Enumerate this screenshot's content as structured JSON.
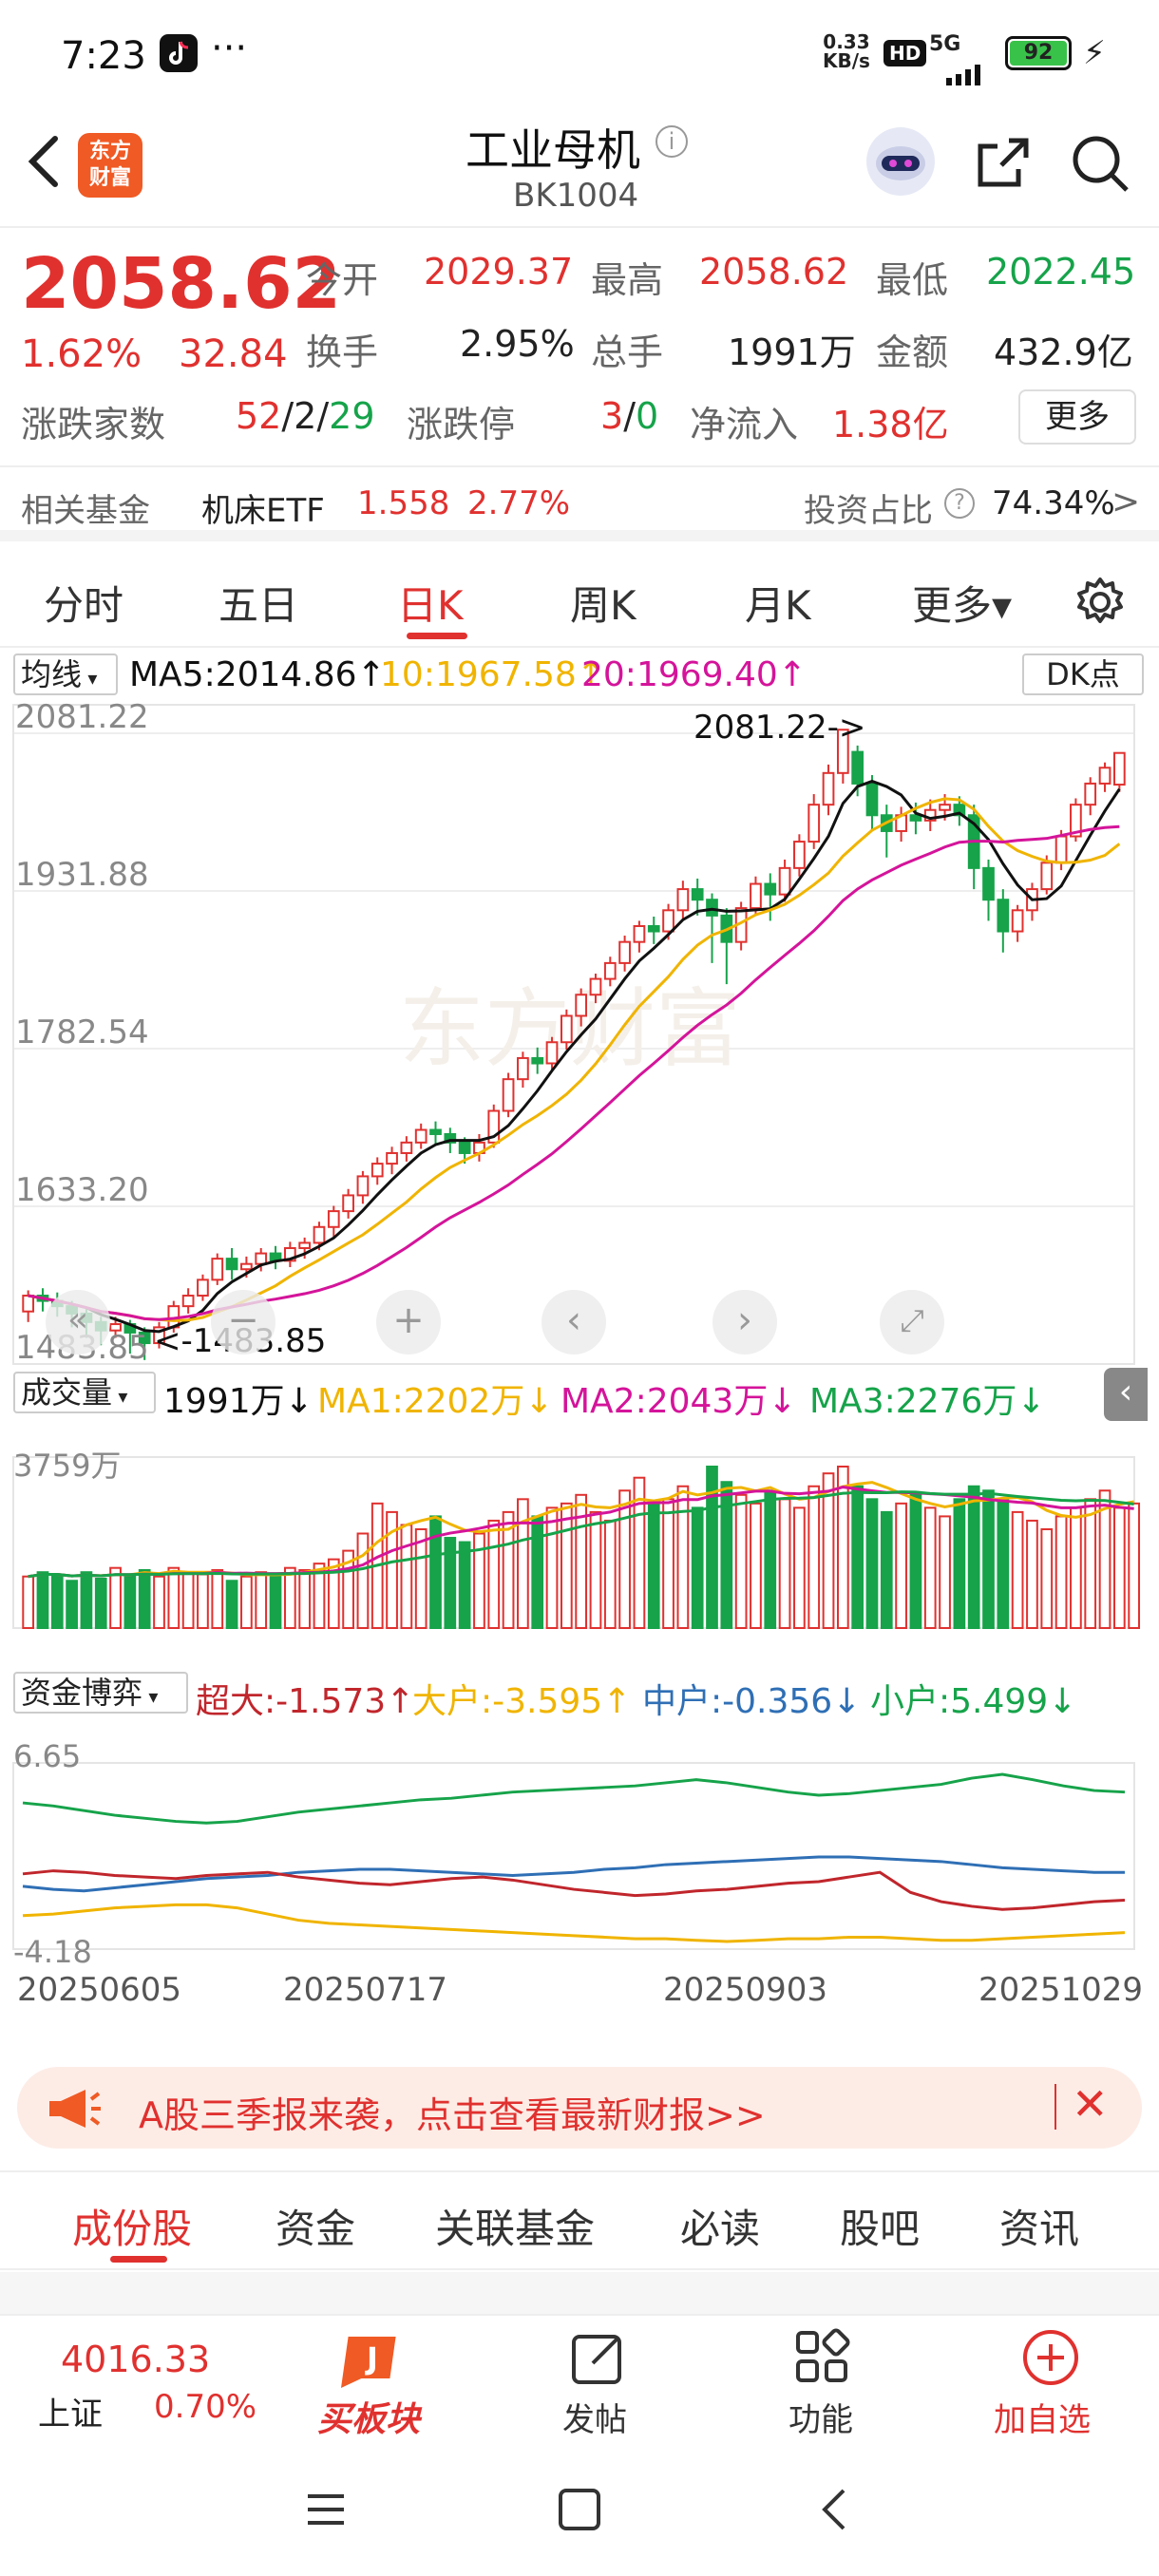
{
  "status_bar": {
    "time": "7:23",
    "net_speed_top": "0.33",
    "net_speed_bottom": "KB/s",
    "hd": "HD",
    "signal": "5G",
    "battery": "92"
  },
  "header": {
    "logo_line1": "东方",
    "logo_line2": "财富",
    "title": "工业母机",
    "code": "BK1004"
  },
  "quote": {
    "price": "2058.62",
    "change_pct": "1.62%",
    "change": "32.84",
    "open_label": "今开",
    "open": "2029.37",
    "high_label": "最高",
    "high": "2058.62",
    "low_label": "最低",
    "low": "2022.45",
    "turnover_label": "换手",
    "turnover": "2.95%",
    "volume_label": "总手",
    "volume": "1991万",
    "amount_label": "金额",
    "amount": "432.9亿",
    "breadth_label": "涨跌家数",
    "breadth_up": "52",
    "breadth_flat": "2",
    "breadth_down": "29",
    "limit_label": "涨跌停",
    "limit_up": "3",
    "limit_down": "0",
    "netflow_label": "净流入",
    "netflow": "1.38亿",
    "more_button": "更多"
  },
  "fund": {
    "label": "相关基金",
    "name": "机床ETF",
    "price": "1.558",
    "pct": "2.77%",
    "ratio_label": "投资占比",
    "ratio": "74.34%",
    "arrow": ">"
  },
  "tabs": [
    {
      "label": "分时"
    },
    {
      "label": "五日"
    },
    {
      "label": "日K"
    },
    {
      "label": "周K"
    },
    {
      "label": "月K"
    },
    {
      "label": "更多▾"
    }
  ],
  "ma_bar": {
    "selector": "均线",
    "ma5": "MA5:2014.86",
    "ma10": "10:1967.58",
    "ma20": "20:1969.40",
    "dk": "DK点"
  },
  "vol_bar": {
    "selector": "成交量",
    "vol": "1991万",
    "ma1": "MA1:2202万",
    "ma2": "MA2:2043万",
    "ma3": "MA3:2276万"
  },
  "flow_bar": {
    "selector": "资金博弈",
    "super": "超大:-1.573",
    "big": "大户:-3.595",
    "mid": "中户:-0.356",
    "small": "小户:5.499"
  },
  "chart_labels": {
    "max_label": "2081.22->",
    "min_label": "<-1483.85",
    "vol_max": "3759万",
    "flow_max": "6.65",
    "flow_min": "-4.18"
  },
  "colors": {
    "up": "#e0312f",
    "down": "#16a34a",
    "ma5": "#111111",
    "ma10": "#f0b400",
    "ma20": "#d4149a",
    "mid": "#2f6fb5"
  },
  "chart_data": [
    {
      "type": "candlestick",
      "title": "",
      "y_ticks": [
        "2081.22",
        "1931.88",
        "1782.54",
        "1633.20",
        "1483.85"
      ],
      "ylim": [
        1483.85,
        2081.22
      ],
      "x_ticks": [
        "20250605",
        "20250717",
        "20250903",
        "20251029"
      ],
      "candles": [
        [
          1530,
          1545,
          1520,
          1550
        ],
        [
          1545,
          1540,
          1530,
          1552
        ],
        [
          1540,
          1535,
          1525,
          1548
        ],
        [
          1535,
          1528,
          1515,
          1540
        ],
        [
          1528,
          1520,
          1505,
          1533
        ],
        [
          1520,
          1512,
          1498,
          1525
        ],
        [
          1512,
          1518,
          1505,
          1525
        ],
        [
          1518,
          1510,
          1490,
          1522
        ],
        [
          1510,
          1500,
          1484,
          1515
        ],
        [
          1500,
          1515,
          1495,
          1520
        ],
        [
          1515,
          1535,
          1510,
          1540
        ],
        [
          1535,
          1545,
          1528,
          1552
        ],
        [
          1545,
          1560,
          1540,
          1565
        ],
        [
          1560,
          1580,
          1555,
          1585
        ],
        [
          1580,
          1570,
          1560,
          1590
        ],
        [
          1570,
          1575,
          1562,
          1582
        ],
        [
          1575,
          1585,
          1568,
          1590
        ],
        [
          1585,
          1578,
          1570,
          1592
        ],
        [
          1578,
          1590,
          1572,
          1596
        ],
        [
          1590,
          1595,
          1580,
          1600
        ],
        [
          1595,
          1610,
          1588,
          1615
        ],
        [
          1610,
          1625,
          1600,
          1630
        ],
        [
          1625,
          1640,
          1618,
          1646
        ],
        [
          1640,
          1658,
          1632,
          1663
        ],
        [
          1658,
          1670,
          1650,
          1676
        ],
        [
          1670,
          1680,
          1660,
          1686
        ],
        [
          1680,
          1690,
          1672,
          1696
        ],
        [
          1690,
          1702,
          1684,
          1708
        ],
        [
          1702,
          1698,
          1688,
          1710
        ],
        [
          1698,
          1690,
          1680,
          1704
        ],
        [
          1690,
          1680,
          1670,
          1695
        ],
        [
          1680,
          1690,
          1672,
          1698
        ],
        [
          1690,
          1720,
          1685,
          1726
        ],
        [
          1720,
          1750,
          1714,
          1756
        ],
        [
          1750,
          1770,
          1742,
          1776
        ],
        [
          1770,
          1765,
          1755,
          1780
        ],
        [
          1765,
          1785,
          1758,
          1790
        ],
        [
          1785,
          1810,
          1778,
          1816
        ],
        [
          1810,
          1830,
          1800,
          1836
        ],
        [
          1830,
          1845,
          1822,
          1850
        ],
        [
          1845,
          1860,
          1838,
          1866
        ],
        [
          1860,
          1880,
          1852,
          1886
        ],
        [
          1880,
          1895,
          1870,
          1900
        ],
        [
          1895,
          1890,
          1878,
          1904
        ],
        [
          1890,
          1910,
          1882,
          1916
        ],
        [
          1910,
          1930,
          1900,
          1938
        ],
        [
          1930,
          1920,
          1905,
          1940
        ],
        [
          1920,
          1905,
          1860,
          1926
        ],
        [
          1905,
          1880,
          1840,
          1912
        ],
        [
          1880,
          1912,
          1872,
          1918
        ],
        [
          1912,
          1935,
          1905,
          1942
        ],
        [
          1935,
          1925,
          1900,
          1945
        ],
        [
          1925,
          1950,
          1918,
          1958
        ],
        [
          1950,
          1975,
          1942,
          1982
        ],
        [
          1975,
          2010,
          1968,
          2020
        ],
        [
          2010,
          2040,
          2000,
          2048
        ],
        [
          2040,
          2081,
          2030,
          2081
        ],
        [
          2060,
          2030,
          2018,
          2066
        ],
        [
          2030,
          2000,
          1985,
          2038
        ],
        [
          2000,
          1985,
          1960,
          2010
        ],
        [
          1985,
          2000,
          1975,
          2008
        ],
        [
          2000,
          1995,
          1982,
          2012
        ],
        [
          1995,
          2005,
          1985,
          2015
        ],
        [
          2005,
          2010,
          1995,
          2020
        ],
        [
          2010,
          2000,
          1990,
          2018
        ],
        [
          2000,
          1950,
          1930,
          2010
        ],
        [
          1950,
          1920,
          1900,
          1958
        ],
        [
          1920,
          1890,
          1870,
          1930
        ],
        [
          1890,
          1910,
          1880,
          1915
        ],
        [
          1910,
          1930,
          1900,
          1936
        ],
        [
          1930,
          1955,
          1925,
          1962
        ],
        [
          1955,
          1980,
          1948,
          1986
        ],
        [
          1980,
          2010,
          1975,
          2016
        ],
        [
          2010,
          2030,
          2000,
          2036
        ],
        [
          2030,
          2045,
          2022,
          2050
        ],
        [
          2029,
          2059,
          2022,
          2059
        ]
      ]
    },
    {
      "type": "bar",
      "title": "",
      "ylabel_max": "3759万",
      "values": [
        1200,
        1300,
        1250,
        1100,
        1300,
        1150,
        1400,
        1250,
        1350,
        1200,
        1400,
        1300,
        1250,
        1350,
        1100,
        1200,
        1300,
        1250,
        1400,
        1350,
        1500,
        1600,
        1800,
        2200,
        2900,
        2700,
        2400,
        2300,
        2600,
        2100,
        2000,
        2200,
        2500,
        2700,
        3000,
        2600,
        2800,
        2900,
        3100,
        2700,
        2500,
        3200,
        3500,
        2900,
        3000,
        3300,
        2800,
        3759,
        3400,
        3100,
        2900,
        3200,
        3000,
        2800,
        3300,
        3600,
        3759,
        3300,
        3000,
        2700,
        2900,
        3100,
        2800,
        2600,
        3000,
        3300,
        3200,
        3000,
        2700,
        2500,
        2300,
        2600,
        2800,
        3000,
        3200,
        2800,
        2900
      ],
      "series": [
        {
          "name": "MA1",
          "color": "#f0b400"
        },
        {
          "name": "MA2",
          "color": "#d4149a"
        },
        {
          "name": "MA3",
          "color": "#16a34a"
        }
      ]
    },
    {
      "type": "line",
      "title": "",
      "ylim": [
        -4.18,
        6.65
      ],
      "series": [
        {
          "name": "小户",
          "color": "#16a34a",
          "values": [
            4.8,
            4.6,
            4.3,
            4.0,
            3.8,
            3.6,
            3.5,
            3.6,
            3.9,
            4.2,
            4.4,
            4.6,
            4.8,
            5.0,
            5.1,
            5.3,
            5.5,
            5.6,
            5.7,
            5.8,
            5.9,
            6.1,
            6.3,
            6.1,
            5.8,
            5.5,
            5.3,
            5.4,
            5.6,
            5.8,
            6.0,
            6.4,
            6.65,
            6.3,
            5.9,
            5.6,
            5.5
          ]
        },
        {
          "name": "中户",
          "color": "#2f6fb5",
          "values": [
            -0.6,
            -0.8,
            -0.9,
            -0.7,
            -0.5,
            -0.3,
            -0.1,
            0.0,
            0.1,
            0.3,
            0.4,
            0.5,
            0.5,
            0.4,
            0.3,
            0.2,
            0.1,
            0.2,
            0.3,
            0.5,
            0.6,
            0.8,
            0.9,
            1.0,
            1.1,
            1.2,
            1.3,
            1.3,
            1.2,
            1.1,
            1.0,
            0.8,
            0.6,
            0.5,
            0.4,
            0.3,
            0.3
          ]
        },
        {
          "name": "超大",
          "color": "#c0262c",
          "values": [
            0.2,
            0.4,
            0.3,
            0.1,
            0.0,
            -0.1,
            0.1,
            0.2,
            0.3,
            0.0,
            -0.2,
            -0.4,
            -0.5,
            -0.3,
            -0.1,
            0.0,
            -0.2,
            -0.5,
            -0.8,
            -1.0,
            -1.2,
            -1.1,
            -0.9,
            -0.8,
            -0.6,
            -0.4,
            -0.3,
            0.0,
            0.3,
            -1.0,
            -1.6,
            -1.9,
            -2.1,
            -2.0,
            -1.8,
            -1.6,
            -1.5
          ]
        },
        {
          "name": "大户",
          "color": "#f0b400",
          "values": [
            -2.5,
            -2.4,
            -2.2,
            -2.0,
            -1.9,
            -1.8,
            -1.8,
            -2.0,
            -2.4,
            -2.8,
            -3.0,
            -3.1,
            -3.2,
            -3.3,
            -3.4,
            -3.5,
            -3.6,
            -3.7,
            -3.8,
            -3.9,
            -4.0,
            -4.0,
            -4.1,
            -4.18,
            -4.1,
            -4.0,
            -4.0,
            -3.9,
            -3.9,
            -4.0,
            -4.1,
            -4.1,
            -4.0,
            -3.9,
            -3.8,
            -3.7,
            -3.6
          ]
        }
      ]
    }
  ],
  "chart_buttons": {
    "plus": "+",
    "minus": "−"
  },
  "banner": {
    "text": "A股三季报来袭，点击查看最新财报>>"
  },
  "subtabs": [
    {
      "label": "成份股"
    },
    {
      "label": "资金"
    },
    {
      "label": "关联基金"
    },
    {
      "label": "必读"
    },
    {
      "label": "股吧"
    },
    {
      "label": "资讯"
    }
  ],
  "bottom": {
    "index_value": "4016.33",
    "index_name": "上证",
    "index_pct": "0.70%",
    "buy_label": "买板块",
    "post_label": "发帖",
    "func_label": "功能",
    "add_label": "加自选"
  }
}
